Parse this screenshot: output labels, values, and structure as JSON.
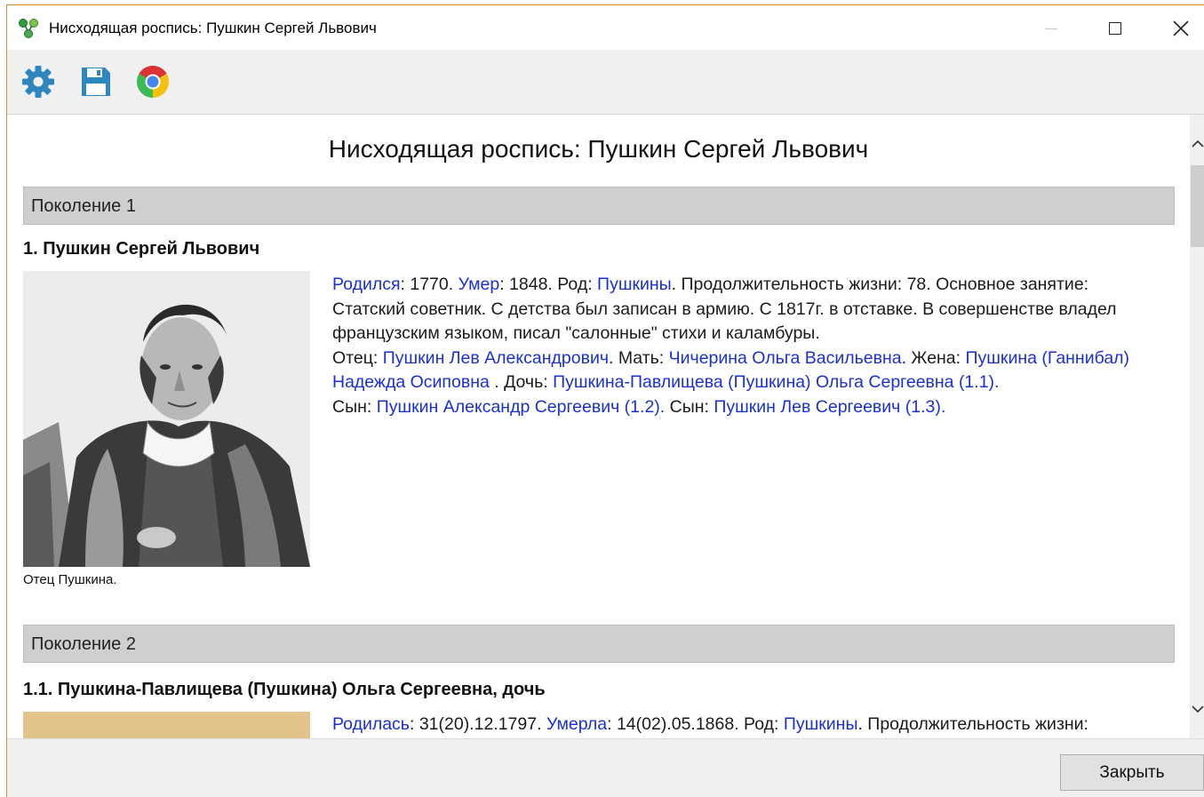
{
  "window": {
    "title": "Нисходящая роспись: Пушкин Сергей Львович"
  },
  "toolbar": {
    "buttons": [
      {
        "icon": "gear-icon"
      },
      {
        "icon": "save-icon"
      },
      {
        "icon": "chrome-icon"
      }
    ]
  },
  "report": {
    "title": "Нисходящая роспись: Пушкин Сергей Львович",
    "generations": [
      {
        "header": "Поколение 1",
        "person": {
          "name": "1. Пушкин Сергей Львович",
          "photo_caption": "Отец Пушкина.",
          "bio": {
            "born_label": "Родился",
            "born_value": ": 1770. ",
            "died_label": "Умер",
            "died_value": ": 1848. Род: ",
            "clan_link": "Пушкины",
            "text1": ". Продолжительность жизни: 78. Основное занятие: Статский советник. С детства был записан в армию. С 1817г. в отставке. В совершенстве владел французским языком, писал \"салонные\" стихи и каламбуры.",
            "father_label": "Отец: ",
            "father_link": "Пушкин Лев Александрович",
            "mother_label": ". Мать: ",
            "mother_link": "Чичерина Ольга Васильевна",
            "wife_label": ". Жена: ",
            "wife_link": "Пушкина (Ганнибал) Надежда Осиповна",
            "daughter_label": " . Дочь: ",
            "daughter_link": "Пушкина-Павлищева (Пушкина) Ольга Сергеевна (1.1).",
            "son1_label": "Сын: ",
            "son1_link": "Пушкин Александр Сергеевич (1.2).",
            "son2_label": " Сын: ",
            "son2_link": "Пушкин Лев Сергеевич (1.3)."
          }
        }
      },
      {
        "header": "Поколение 2",
        "person": {
          "name": "1.1. Пушкина-Павлищева (Пушкина) Ольга Сергеевна, дочь",
          "bio": {
            "born_label": "Родилась",
            "born_value": ": 31(20).12.1797. ",
            "died_label": "Умерла",
            "died_value": ": 14(02).05.1868. Род: ",
            "clan_link": "Пушкины",
            "text1": ". Продолжительность жизни:"
          }
        }
      }
    ]
  },
  "footer": {
    "close_label": "Закрыть"
  },
  "colors": {
    "link": "#1a2fd6",
    "generation_header_bg": "#cfcfcf",
    "title_border": "#e08a3c"
  }
}
